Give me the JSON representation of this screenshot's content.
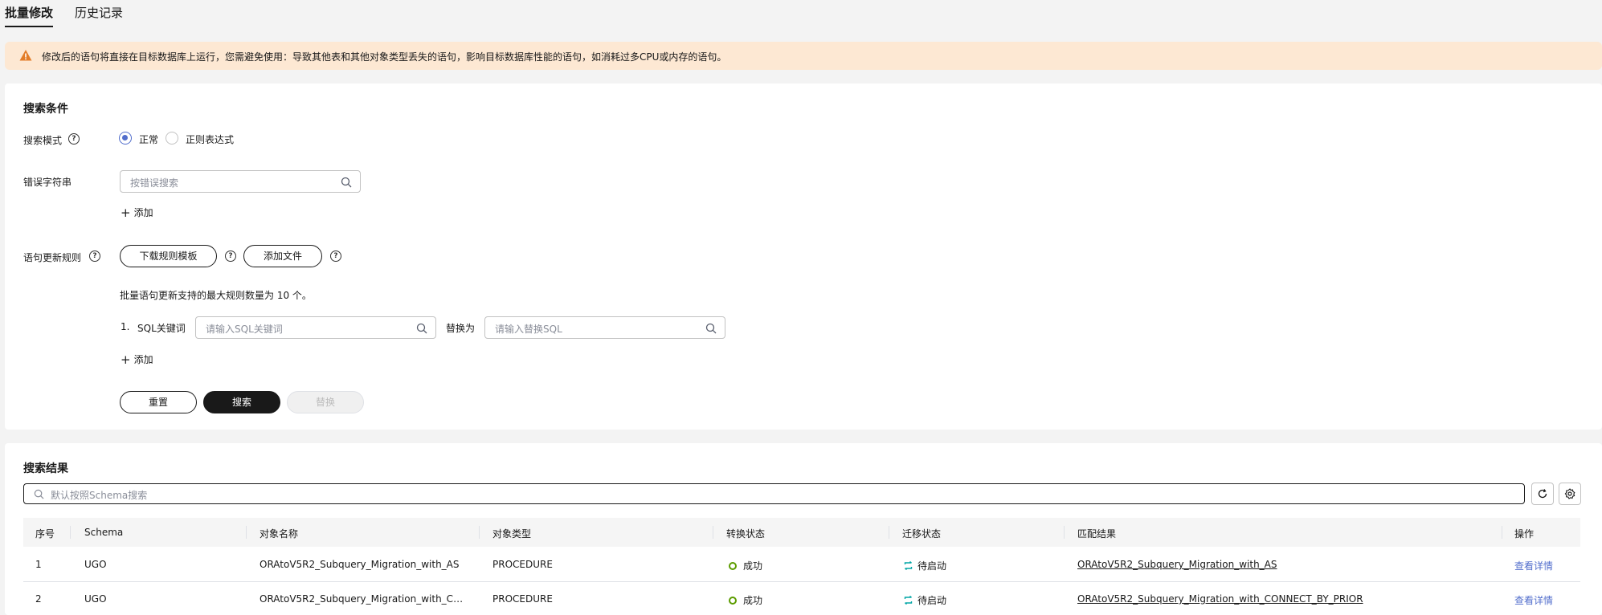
{
  "tabs": [
    {
      "label": "批量修改"
    },
    {
      "label": "历史记录"
    }
  ],
  "notice": {
    "text": "修改后的语句将直接在目标数据库上运行，您需避免使用：导致其他表和其他对象类型丢失的语句，影响目标数据库性能的语句，如消耗过多CPU或内存的语句。"
  },
  "search_conditions": {
    "title": "搜索条件",
    "mode_label": "搜索模式",
    "mode_options": [
      {
        "label": "正常",
        "selected": true
      },
      {
        "label": "正则表达式",
        "selected": false
      }
    ],
    "error_label": "错误字符串",
    "error_placeholder": "按错误搜索",
    "add_label": "添加",
    "rule_label": "语句更新规则",
    "download_btn": "下载规则模板",
    "add_file_btn": "添加文件",
    "max_rules_text": "批量语句更新支持的最大规则数量为 10 个。",
    "rule_index": "1.",
    "sql_keyword_label": "SQL关键词",
    "sql_keyword_placeholder": "请输入SQL关键词",
    "replace_label": "替换为",
    "replace_placeholder": "请输入替换SQL",
    "add_label2": "添加",
    "reset_btn": "重置",
    "search_btn": "搜索",
    "replace_btn": "替换"
  },
  "results": {
    "title": "搜索结果",
    "search_placeholder": "默认按照Schema搜索",
    "columns": [
      "序号",
      "Schema",
      "对象名称",
      "对象类型",
      "转换状态",
      "迁移状态",
      "匹配结果",
      "操作"
    ],
    "rows": [
      {
        "index": "1",
        "schema": "UGO",
        "name": "ORAtoV5R2_Subquery_Migration_with_AS",
        "type": "PROCEDURE",
        "convert": "成功",
        "migrate": "待启动",
        "match": "ORAtoV5R2_Subquery_Migration_with_AS",
        "action": "查看详情"
      },
      {
        "index": "2",
        "schema": "UGO",
        "name": "ORAtoV5R2_Subquery_Migration_with_CON...",
        "type": "PROCEDURE",
        "convert": "成功",
        "migrate": "待启动",
        "match": "ORAtoV5R2_Subquery_Migration_with_CONNECT_BY_PRIOR",
        "action": "查看详情"
      }
    ]
  },
  "colors": {
    "accent": "#526ecc",
    "primary_button": "#191919",
    "notice_bg": "#fde8d3",
    "success": "#5c9c00",
    "pending": "#00a5a5"
  }
}
